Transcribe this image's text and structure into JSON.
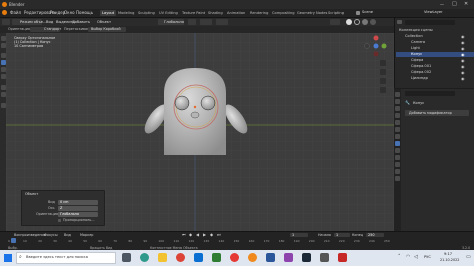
{
  "app": {
    "title": "Blender"
  },
  "menu": [
    "Файл",
    "Редактировать",
    "Рендер",
    "Окно",
    "Помощь"
  ],
  "workspaces": [
    "Layout",
    "Modeling",
    "Sculpting",
    "UV Editing",
    "Texture Paint",
    "Shading",
    "Animation",
    "Rendering",
    "Compositing",
    "Geometry Nodes",
    "Scripting"
  ],
  "scene": {
    "name": "Scene",
    "view_layer": "ViewLayer"
  },
  "header3d": {
    "mode": "Режим объе...",
    "view": "Вид",
    "select": "Выделить",
    "add": "Добавить",
    "object": "Объект",
    "orientation": "Глобально"
  },
  "header3d2": {
    "orientation": "Ориентация:",
    "orientation_value": "Стандарт",
    "drag": "Перетаскивание:",
    "drag_value": "Выбор Коробкой"
  },
  "viewport_info": {
    "line1": "Сверху Ортогональное",
    "line2": "(1) Collection | Конус",
    "line3": "10 Сантиметров"
  },
  "outliner": {
    "title": "Коллекция сцены",
    "rows": [
      "Collection",
      "Camera",
      "Light",
      "Конус",
      "Сфера",
      "Сфера.001",
      "Сфера.002",
      "Цилиндр"
    ]
  },
  "props": {
    "object_name": "Конус",
    "modifier": "Добавить модификатор"
  },
  "operator": {
    "title": "Объект",
    "fields": [
      {
        "label": "Вид",
        "value": "0 cm"
      },
      {
        "label": "Ось",
        "value": "Z"
      },
      {
        "label": "Ориентация",
        "value": "Глобально"
      }
    ],
    "checkbox_label": "Пропорциональ...",
    "checkbox_value": "Prop. Edit"
  },
  "timeline": {
    "labels": [
      "Воспроизведение",
      "Фокусы",
      "Вид",
      "Маркер"
    ],
    "frame": "1",
    "start_label": "Начало",
    "start": "1",
    "end_label": "Конец",
    "end": "250",
    "ticks": [
      "0",
      "10",
      "20",
      "30",
      "40",
      "50",
      "60",
      "70",
      "80",
      "90",
      "100",
      "110",
      "120",
      "130",
      "140",
      "150",
      "160",
      "170",
      "180",
      "190",
      "200",
      "210",
      "220",
      "230",
      "240",
      "250"
    ]
  },
  "statusbar": {
    "left": "Выбр.",
    "mid": "Вращать Вид",
    "right": "Контекстное Меню Объекта",
    "version": "3.2.0"
  },
  "taskbar": {
    "search_placeholder": "Введите здесь текст для поиска",
    "time": "9:17",
    "date": "21.10.2022",
    "lang": "РУС"
  }
}
